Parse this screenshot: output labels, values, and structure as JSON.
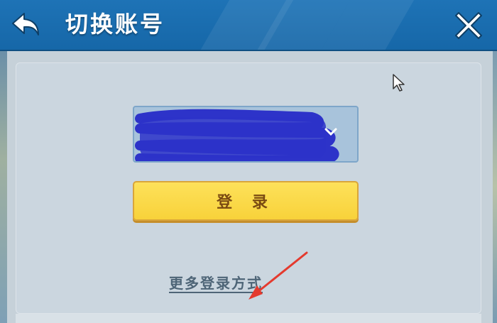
{
  "header": {
    "title": "切换账号",
    "back_icon": "back-arrow-icon",
    "close_icon": "close-icon",
    "color": "#1b6fb2"
  },
  "account": {
    "value": "",
    "dropdown_icon": "chevron-down-icon",
    "redaction_color": "#2d33c9"
  },
  "login_button": {
    "label": "登 录",
    "color": "#fbd949"
  },
  "more_login": {
    "label": "更多登录方式"
  },
  "annotation": {
    "arrow_color": "#e43a2e"
  }
}
